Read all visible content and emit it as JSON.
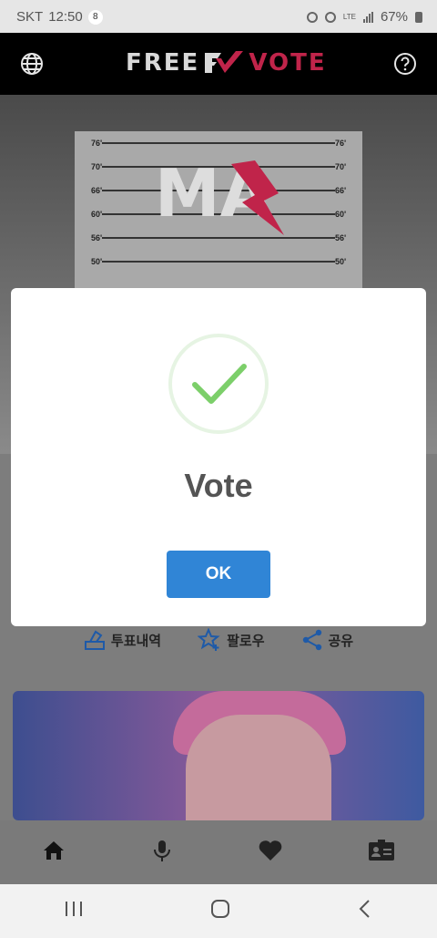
{
  "status_bar": {
    "carrier": "SKT",
    "time": "12:50",
    "notification_count": "8",
    "network": "LTE",
    "battery": "67%"
  },
  "header": {
    "logo_free": "FREE",
    "logo_vote": "VOTE"
  },
  "hero": {
    "title": "MA"
  },
  "height_marks": [
    "76'",
    "70'",
    "66'",
    "60'",
    "56'",
    "50'"
  ],
  "actions": {
    "history_label": "투표내역",
    "follow_label": "팔로우",
    "share_label": "공유"
  },
  "modal": {
    "title": "Vote",
    "ok_label": "OK"
  },
  "colors": {
    "accent": "#3085d6",
    "brand": "#c0244a",
    "success": "#7ccf6a"
  }
}
